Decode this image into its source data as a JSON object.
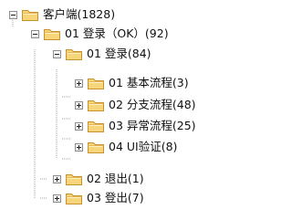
{
  "tree": {
    "root": {
      "label": "客户端(1828)",
      "state": "expanded",
      "icon": "folder-icon"
    },
    "level1": [
      {
        "label": "01 登录（OK）(92)",
        "state": "expanded",
        "icon": "folder-icon"
      }
    ],
    "level2": [
      {
        "label": "01 登录(84)",
        "state": "expanded",
        "icon": "folder-icon"
      },
      {
        "label": "02 退出(1)",
        "state": "collapsed",
        "icon": "folder-icon"
      },
      {
        "label": "03 登出(7)",
        "state": "collapsed",
        "icon": "folder-icon"
      }
    ],
    "level3": [
      {
        "label": "01 基本流程(3)",
        "state": "collapsed",
        "icon": "folder-icon"
      },
      {
        "label": "02 分支流程(48)",
        "state": "collapsed",
        "icon": "folder-icon"
      },
      {
        "label": "03 异常流程(25)",
        "state": "collapsed",
        "icon": "folder-icon"
      },
      {
        "label": "04 UI验证(8)",
        "state": "collapsed",
        "icon": "folder-icon"
      }
    ]
  },
  "colors": {
    "folder_fill": "#f7d57a",
    "folder_stroke": "#c7922d",
    "tree_line": "#a0a0a0",
    "text": "#111111"
  }
}
